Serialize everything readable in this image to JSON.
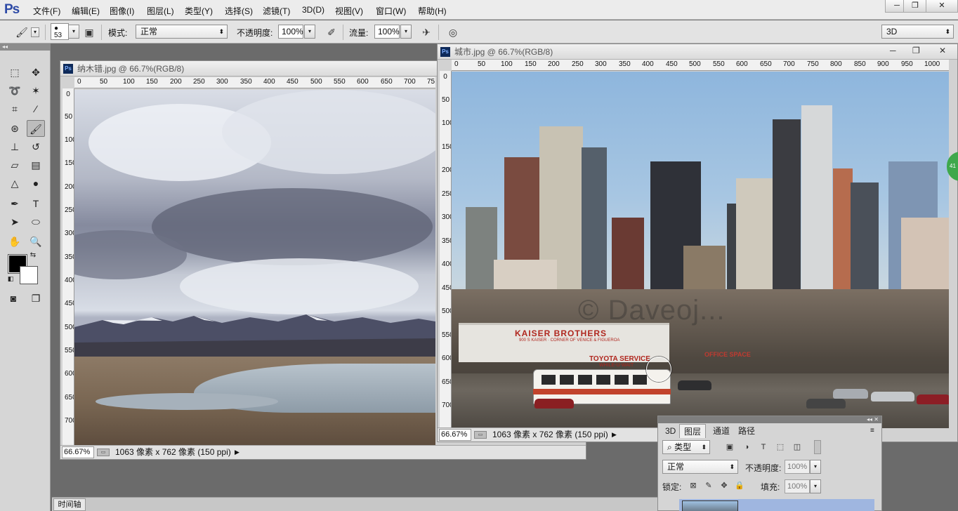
{
  "menubar": {
    "logo": "Ps",
    "items": [
      "文件(F)",
      "编辑(E)",
      "图像(I)",
      "图层(L)",
      "类型(Y)",
      "选择(S)",
      "滤镜(T)",
      "3D(D)",
      "视图(V)",
      "窗口(W)",
      "帮助(H)"
    ],
    "window_controls": {
      "minimize": "─",
      "restore": "❐",
      "close": "✕"
    }
  },
  "options_bar": {
    "brush_size": "53",
    "mode_label": "模式:",
    "mode_value": "正常",
    "opacity_label": "不透明度:",
    "opacity_value": "100%",
    "flow_label": "流量:",
    "flow_value": "100%",
    "workspace_value": "3D"
  },
  "doc_namtso": {
    "title": "纳木错.jpg @ 66.7%(RGB/8)",
    "zoom": "66.67%",
    "status": "1063 像素 x 762 像素 (150 ppi)",
    "ruler_h": [
      "0",
      "50",
      "100",
      "150",
      "200",
      "250",
      "300",
      "350",
      "400",
      "450",
      "500",
      "550",
      "600",
      "650",
      "700",
      "75"
    ],
    "ruler_v": [
      "0",
      "50",
      "100",
      "150",
      "200",
      "250",
      "300",
      "350",
      "400",
      "450",
      "500",
      "550",
      "600",
      "650",
      "700"
    ]
  },
  "doc_city": {
    "title": "城市.jpg @ 66.7%(RGB/8)",
    "zoom": "66.67%",
    "status": "1063 像素 x 762 像素 (150 ppi)",
    "ruler_h": [
      "0",
      "50",
      "100",
      "150",
      "200",
      "250",
      "300",
      "350",
      "400",
      "450",
      "500",
      "550",
      "600",
      "650",
      "700",
      "750",
      "800",
      "850",
      "900",
      "950",
      "1000"
    ],
    "ruler_v": [
      "0",
      "50",
      "100",
      "150",
      "200",
      "250",
      "300",
      "350",
      "400",
      "450",
      "500",
      "550",
      "600",
      "650",
      "700"
    ],
    "signs": {
      "kaiser": "KAISER BROTHERS",
      "kaiser_sub": "900 S KAISER · CORNER OF VENICE & FIGUEROA",
      "toyota": "TOYOTA SERVICE",
      "toyota_sub": "WHILE-U-WAIT",
      "office": "OFFICE SPACE",
      "watermark": "© Daveoj..."
    }
  },
  "layers_panel": {
    "tabs": [
      "3D",
      "图层",
      "通道",
      "路径"
    ],
    "active_tab": "图层",
    "filter_value": "类型",
    "blend_value": "正常",
    "opacity_label": "不透明度:",
    "opacity_value": "100%",
    "lock_label": "锁定:",
    "fill_label": "填充:",
    "fill_value": "100%"
  },
  "timeline": {
    "label": "时间轴"
  },
  "side_badge": {
    "label": "41"
  },
  "colors": {
    "foreground": "#000000",
    "background": "#ffffff",
    "accent": "#2d4aa6"
  }
}
